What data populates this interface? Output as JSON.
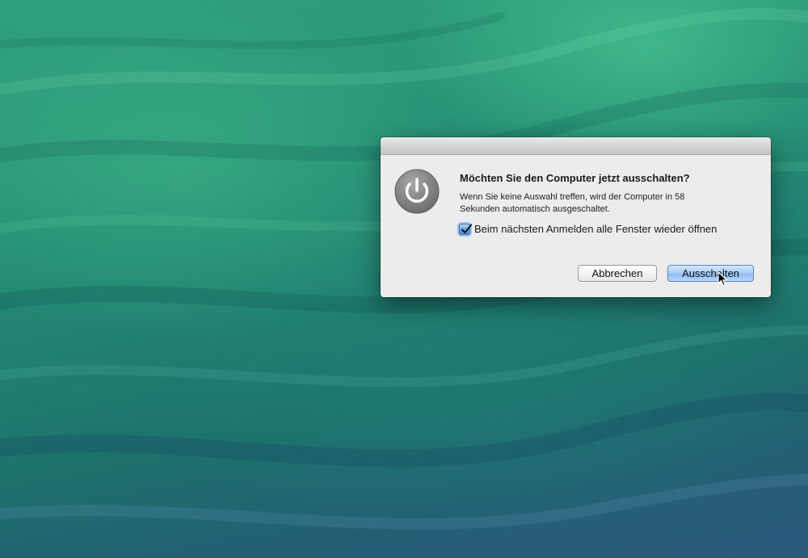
{
  "dialog": {
    "icon": "power-icon",
    "title": "Möchten Sie den Computer jetzt ausschalten?",
    "message": "Wenn Sie keine Auswahl treffen, wird der Computer in 58 Sekunden automatisch ausgeschaltet.",
    "checkbox": {
      "label": "Beim nächsten Anmelden alle Fenster wieder öffnen",
      "checked": true
    },
    "buttons": {
      "cancel": "Abbrechen",
      "confirm": "Ausschalten"
    }
  },
  "colors": {
    "wallpaper_green": "#2a9678",
    "wallpaper_blue": "#2a5a7c",
    "dialog_bg": "#ececec",
    "default_button": "#a9cdf5"
  }
}
